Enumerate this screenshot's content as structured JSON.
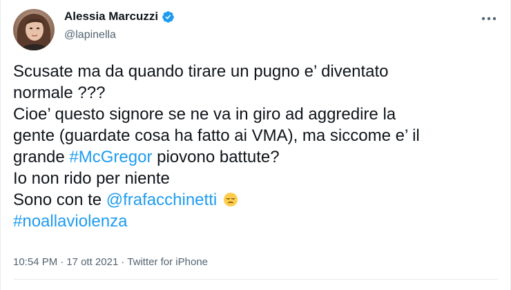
{
  "author": {
    "name": "Alessia Marcuzzi",
    "handle": "@lapinella",
    "verified": true,
    "avatar_icon": "profile-photo"
  },
  "menu_icon": "more-horizontal-icon",
  "tweet": {
    "line1": "Scusate ma da quando tirare un pugno e’ diventato",
    "line2": "normale ???",
    "line3": "Cioe’ questo signore se ne va in giro ad aggredire la",
    "line4": "gente (guardate cosa ha fatto ai VMA), ma siccome e’ il",
    "line5_prefix": "grande ",
    "line5_hashtag": "#McGregor",
    "line5_suffix": " piovono battute?",
    "line6": "Io non rido per niente",
    "line7_prefix": "Sono con te ",
    "line7_mention": "@frafacchinetti",
    "line7_emoji": "pensive-face-emoji",
    "line8_hashtag": "#noallaviolenza"
  },
  "meta": {
    "time": "10:54 PM",
    "separator": "·",
    "date": "17 ott 2021",
    "source": "Twitter for iPhone"
  },
  "colors": {
    "text": "#0f1419",
    "secondary": "#536471",
    "link": "#1d9bf0",
    "verified": "#1d9bf0"
  }
}
